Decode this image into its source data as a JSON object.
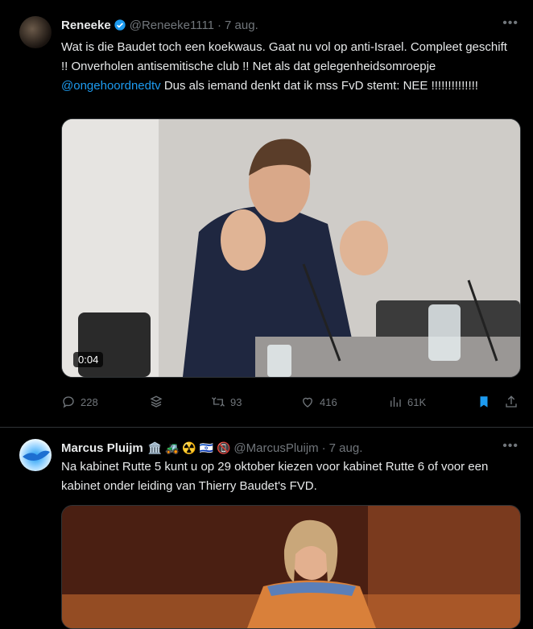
{
  "tweets": [
    {
      "name": "Reneeke",
      "handle": "@Reneeke1111",
      "dot": "·",
      "date": "7 aug.",
      "text_before": "Wat is die Baudet toch een koekwaus. Gaat nu vol op anti-Israel. Compleet geschift !! Onverholen antisemitische club !! Net als dat gelegenheidsomroepje ",
      "mention": "@ongehoordnedtv",
      "text_after": "   Dus als iemand denkt dat ik mss FvD stemt: NEE !!!!!!!!!!!!!!",
      "video_duration": "0:04",
      "replies": "228",
      "retweets": "93",
      "likes": "416",
      "views": "61K"
    },
    {
      "name": "Marcus Pluijm",
      "name_emojis": "🏛️ 🚜 ☢️ 🇮🇱 📵",
      "handle": "@MarcusPluijm",
      "dot": "·",
      "date": "7 aug.",
      "text": "Na kabinet Rutte 5 kunt u op 29 oktober kiezen voor kabinet Rutte 6 of voor een kabinet onder leiding van Thierry Baudet's FVD."
    }
  ],
  "icons": {
    "more": "more-icon",
    "verified": "verified-icon",
    "reply": "reply-icon",
    "grok": "grok-icon",
    "retweet": "retweet-icon",
    "like": "like-icon",
    "views": "views-icon",
    "bookmark": "bookmark-icon",
    "share": "share-icon"
  },
  "colors": {
    "accent": "#1d9bf0",
    "muted": "#71767b",
    "background": "#000000"
  }
}
